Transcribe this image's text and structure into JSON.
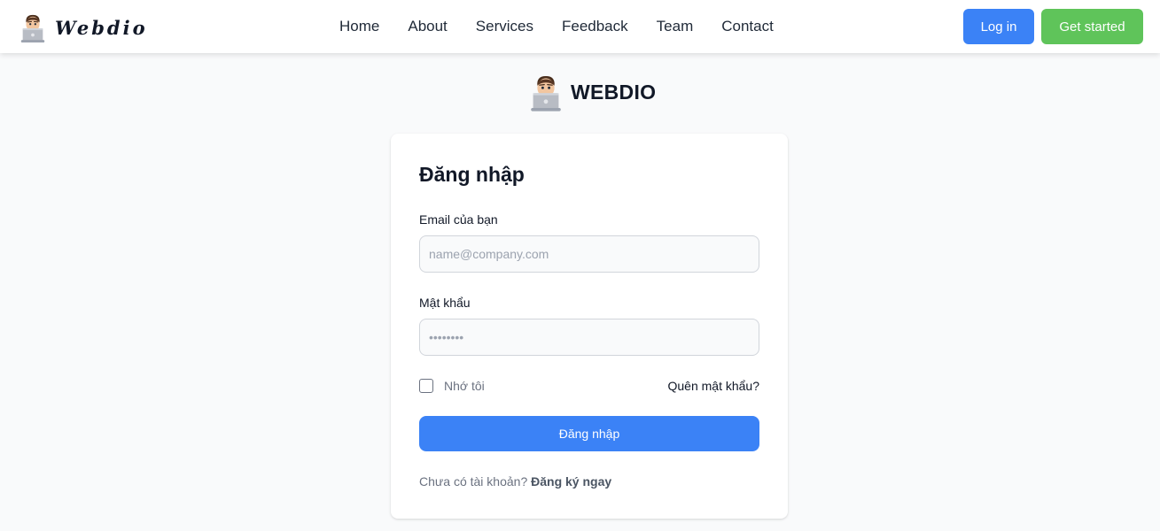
{
  "navbar": {
    "brand": "Webdio",
    "links": [
      "Home",
      "About",
      "Services",
      "Feedback",
      "Team",
      "Contact"
    ],
    "login_label": "Log in",
    "get_started_label": "Get started"
  },
  "logo": {
    "text": "WEBDIO",
    "icon": "avatar-with-laptop-icon"
  },
  "login_form": {
    "title": "Đăng nhập",
    "email_label": "Email của bạn",
    "email_placeholder": "name@company.com",
    "email_value": "",
    "password_label": "Mật khẩu",
    "password_placeholder": "••••••••",
    "password_value": "",
    "remember_label": "Nhớ tôi",
    "remember_checked": false,
    "forgot_label": "Quên mật khẩu?",
    "submit_label": "Đăng nhập",
    "no_account_text": "Chưa có tài khoản?",
    "signup_label": "Đăng ký ngay"
  },
  "colors": {
    "primary": "#3b82f6",
    "success": "#5fc45a",
    "background": "#f9fafb"
  }
}
